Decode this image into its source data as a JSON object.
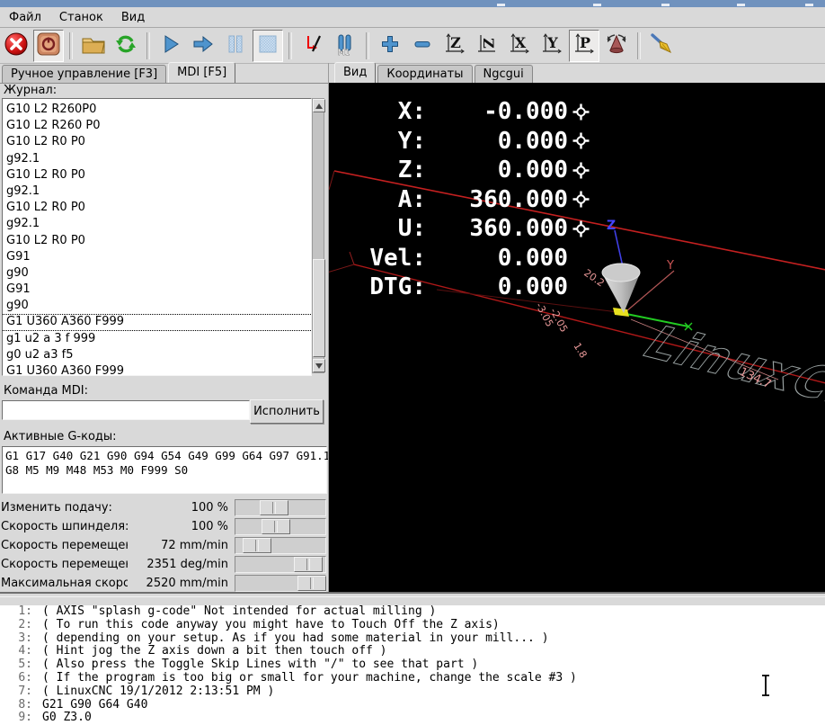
{
  "titlebar": {
    "note": "partially clipped window titlebar"
  },
  "menu": {
    "items": [
      "Файл",
      "Станок",
      "Вид"
    ]
  },
  "toolbar": {
    "buttons": [
      {
        "name": "estop-button",
        "icon": "estop"
      },
      {
        "name": "machine-power-button",
        "icon": "power",
        "pressed": true
      },
      {
        "sep": true
      },
      {
        "name": "open-file-button",
        "icon": "folder"
      },
      {
        "name": "reload-button",
        "icon": "reload"
      },
      {
        "sep": true
      },
      {
        "name": "run-button",
        "icon": "run"
      },
      {
        "name": "step-button",
        "icon": "step"
      },
      {
        "name": "pause-button",
        "icon": "pause"
      },
      {
        "name": "stop-button",
        "icon": "stop",
        "pressed": true
      },
      {
        "sep": true
      },
      {
        "name": "toggle-skip-lines-button",
        "icon": "skip"
      },
      {
        "name": "optional-stop-button",
        "icon": "m1",
        "label": "M1"
      },
      {
        "sep": true
      },
      {
        "name": "zoom-in-button",
        "icon": "plus"
      },
      {
        "name": "zoom-out-button",
        "icon": "minus"
      },
      {
        "name": "view-top-button",
        "icon": "letter",
        "glyph": "Z"
      },
      {
        "name": "view-top-rotated-button",
        "icon": "letter-rot",
        "glyph": "Z"
      },
      {
        "name": "view-side-button",
        "icon": "letter",
        "glyph": "X"
      },
      {
        "name": "view-front-button",
        "icon": "letter",
        "glyph": "Y"
      },
      {
        "name": "view-perspective-button",
        "icon": "letter",
        "glyph": "P",
        "pressed": true
      },
      {
        "name": "rotate-view-button",
        "icon": "cone"
      },
      {
        "sep": true
      },
      {
        "name": "clear-plot-button",
        "icon": "broom"
      }
    ]
  },
  "left": {
    "tabs": [
      {
        "label": "Ручное управление [F3]",
        "selected": false
      },
      {
        "label": "MDI [F5]",
        "selected": true
      }
    ],
    "log_label": "Журнал:",
    "log_lines": [
      "G10 L2 R260P0",
      "G10 L2 R260 P0",
      "G10 L2 R0 P0",
      "g92.1",
      "G10 L2 R0 P0",
      "g92.1",
      "G10 L2 R0 P0",
      "g92.1",
      "G10 L2 R0 P0",
      "G91",
      "g90",
      "G91",
      "g90",
      "G1 U360 A360 F999",
      "g1 u2 a 3 f 999",
      "g0 u2 a3 f5",
      "G1 U360 A360 F999"
    ],
    "selected_log_index": 13,
    "mdi_label": "Команда MDI:",
    "mdi_value": "",
    "execute_label": "Исполнить",
    "gcodes_label": "Активные G-коды:",
    "gcodes_lines": [
      "G1 G17 G40 G21 G90 G94 G54 G49 G99 G64 G97 G91.1",
      "G8 M5 M9 M48 M53 M0 F999 S0"
    ],
    "sliders": [
      {
        "label": "Изменить подачу:",
        "value": "100 %",
        "pos": 0.39
      },
      {
        "label": "Скорость шпинделя:",
        "value": "100 %",
        "pos": 0.41
      },
      {
        "label": "Скорость перемещений",
        "value": "72 mm/min",
        "pos": 0.11
      },
      {
        "label": "Скорость перемещений",
        "value": "2351 deg/min",
        "pos": 0.93
      },
      {
        "label": "Максимальная скорость:",
        "value": "2520 mm/min",
        "pos": 0.99
      }
    ]
  },
  "right": {
    "tabs": [
      {
        "label": "Вид",
        "selected": true
      },
      {
        "label": "Координаты",
        "selected": false
      },
      {
        "label": "Ngcgui",
        "selected": false
      }
    ],
    "dro": [
      {
        "label": "X:",
        "value": "-0.000",
        "homed": true
      },
      {
        "label": "Y:",
        "value": "0.000",
        "homed": true
      },
      {
        "label": "Z:",
        "value": "0.000",
        "homed": true
      },
      {
        "label": "A:",
        "value": "360.000",
        "homed": true
      },
      {
        "label": "U:",
        "value": "360.000",
        "homed": true
      },
      {
        "label": "Vel:",
        "value": "0.000",
        "homed": false
      },
      {
        "label": "DTG:",
        "value": "0.000",
        "homed": false
      }
    ],
    "scene": {
      "axis_z_label": "Z",
      "axis_y_label": "Y",
      "wireframe_text": "LinuxCNC",
      "dim_labels": [
        "20.2",
        "-3.05",
        "-2.05",
        "1.8",
        "134.7"
      ]
    }
  },
  "colors": {
    "titlebar_blue": "#7092be",
    "ui_gray": "#d9d9d9",
    "icon_blue": "#4f94cd",
    "limit_red": "#cc2020",
    "dim_pink": "#e89898",
    "path_green": "#22cc22",
    "tool_cone_gray": "#d8d8d8"
  },
  "listing": {
    "lines": [
      {
        "n": "1:",
        "text": "( AXIS \"splash g-code\" Not intended for actual milling )"
      },
      {
        "n": "2:",
        "text": "( To run this code anyway you might have to Touch Off the Z axis)"
      },
      {
        "n": "3:",
        "text": "( depending on your setup. As if you had some material in your mill... )"
      },
      {
        "n": "4:",
        "text": "( Hint jog the Z axis down a bit then touch off )"
      },
      {
        "n": "5:",
        "text": "( Also press the Toggle Skip Lines with \"/\" to see that part )"
      },
      {
        "n": "6:",
        "text": "( If the program is too big or small for your machine, change the scale #3 )"
      },
      {
        "n": "7:",
        "text": "( LinuxCNC 19/1/2012 2:13:51 PM )"
      },
      {
        "n": "8:",
        "text": "G21 G90 G64 G40"
      },
      {
        "n": "9:",
        "text": "G0 Z3.0"
      }
    ]
  }
}
